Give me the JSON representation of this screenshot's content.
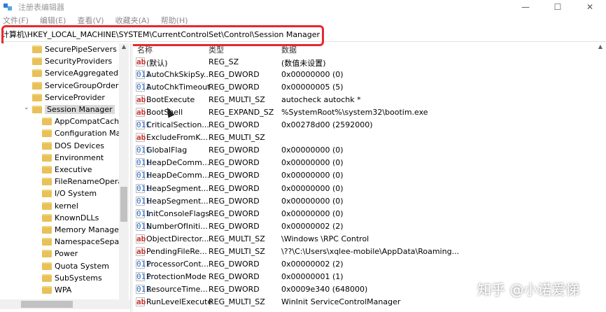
{
  "window": {
    "title": "注册表编辑器",
    "controls": [
      "—",
      "☐",
      "✕"
    ]
  },
  "menu": [
    "文件(F)",
    "编辑(E)",
    "查看(V)",
    "收藏夹(A)",
    "帮助(H)"
  ],
  "address": "计算机\\HKEY_LOCAL_MACHINE\\SYSTEM\\CurrentControlSet\\Control\\Session Manager",
  "tree": {
    "items": [
      {
        "label": "SecurePipeServers",
        "indent": 1
      },
      {
        "label": "SecurityProviders",
        "indent": 1
      },
      {
        "label": "ServiceAggregatedEv",
        "indent": 1
      },
      {
        "label": "ServiceGroupOrder",
        "indent": 1
      },
      {
        "label": "ServiceProvider",
        "indent": 1
      },
      {
        "label": "Session Manager",
        "indent": 1,
        "selected": true,
        "expanded": true
      },
      {
        "label": "AppCompatCache",
        "indent": 2
      },
      {
        "label": "Configuration Mar",
        "indent": 2
      },
      {
        "label": "DOS Devices",
        "indent": 2
      },
      {
        "label": "Environment",
        "indent": 2
      },
      {
        "label": "Executive",
        "indent": 2
      },
      {
        "label": "FileRenameOperat",
        "indent": 2
      },
      {
        "label": "I/O System",
        "indent": 2
      },
      {
        "label": "kernel",
        "indent": 2
      },
      {
        "label": "KnownDLLs",
        "indent": 2
      },
      {
        "label": "Memory Manager",
        "indent": 2
      },
      {
        "label": "NamespaceSepara",
        "indent": 2
      },
      {
        "label": "Power",
        "indent": 2
      },
      {
        "label": "Quota System",
        "indent": 2
      },
      {
        "label": "SubSystems",
        "indent": 2
      },
      {
        "label": "WPA",
        "indent": 2
      }
    ]
  },
  "list": {
    "columns": [
      "名称",
      "类型",
      "数据"
    ],
    "rows": [
      {
        "icon": "sz",
        "name": "(默认)",
        "type": "REG_SZ",
        "data": "(数值未设置)"
      },
      {
        "icon": "bin",
        "name": "AutoChkSkipSy...",
        "type": "REG_DWORD",
        "data": "0x00000000 (0)"
      },
      {
        "icon": "bin",
        "name": "AutoChkTimeout",
        "type": "REG_DWORD",
        "data": "0x00000005 (5)"
      },
      {
        "icon": "sz",
        "name": "BootExecute",
        "type": "REG_MULTI_SZ",
        "data": "autocheck autochk *"
      },
      {
        "icon": "sz",
        "name": "BootShell",
        "type": "REG_EXPAND_SZ",
        "data": "%SystemRoot%\\system32\\bootim.exe"
      },
      {
        "icon": "bin",
        "name": "CriticalSection...",
        "type": "REG_DWORD",
        "data": "0x00278d00 (2592000)"
      },
      {
        "icon": "sz",
        "name": "ExcludeFromK...",
        "type": "REG_MULTI_SZ",
        "data": ""
      },
      {
        "icon": "bin",
        "name": "GlobalFlag",
        "type": "REG_DWORD",
        "data": "0x00000000 (0)"
      },
      {
        "icon": "bin",
        "name": "HeapDeComm...",
        "type": "REG_DWORD",
        "data": "0x00000000 (0)"
      },
      {
        "icon": "bin",
        "name": "HeapDeComm...",
        "type": "REG_DWORD",
        "data": "0x00000000 (0)"
      },
      {
        "icon": "bin",
        "name": "HeapSegment...",
        "type": "REG_DWORD",
        "data": "0x00000000 (0)"
      },
      {
        "icon": "bin",
        "name": "HeapSegment...",
        "type": "REG_DWORD",
        "data": "0x00000000 (0)"
      },
      {
        "icon": "bin",
        "name": "InitConsoleFlags",
        "type": "REG_DWORD",
        "data": "0x00000000 (0)"
      },
      {
        "icon": "bin",
        "name": "NumberOfIniti...",
        "type": "REG_DWORD",
        "data": "0x00000002 (2)"
      },
      {
        "icon": "sz",
        "name": "ObjectDirector...",
        "type": "REG_MULTI_SZ",
        "data": "\\Windows \\RPC Control"
      },
      {
        "icon": "sz",
        "name": "PendingFileRe...",
        "type": "REG_MULTI_SZ",
        "data": "\\??\\C:\\Users\\xqlee-mobile\\AppData\\Roaming..."
      },
      {
        "icon": "bin",
        "name": "ProcessorCont...",
        "type": "REG_DWORD",
        "data": "0x00000002 (2)"
      },
      {
        "icon": "bin",
        "name": "ProtectionMode",
        "type": "REG_DWORD",
        "data": "0x00000001 (1)"
      },
      {
        "icon": "bin",
        "name": "ResourceTime...",
        "type": "REG_DWORD",
        "data": "0x0009e340 (648000)"
      },
      {
        "icon": "sz",
        "name": "RunLevelExecute",
        "type": "REG_MULTI_SZ",
        "data": "WinInit ServiceControlManager"
      }
    ]
  },
  "watermark": "知乎 @小诺爱悌",
  "colors": {
    "highlight": "#e8282d",
    "folder": "#e8c15a",
    "selected": "#d9d9d9"
  }
}
